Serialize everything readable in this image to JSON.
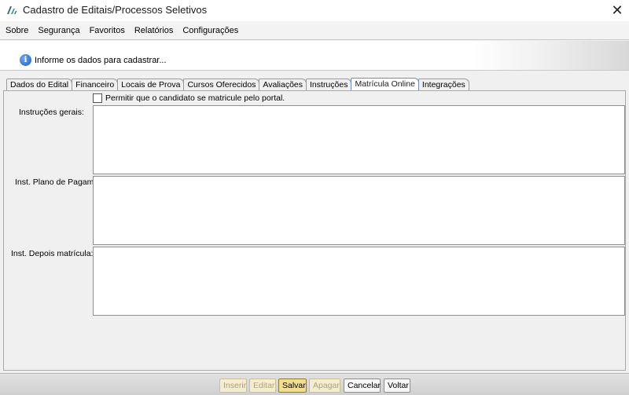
{
  "window": {
    "title": "Cadastro de Editais/Processos Seletivos",
    "close_label": "✕"
  },
  "menu": [
    {
      "label": "Sobre"
    },
    {
      "label": "Segurança"
    },
    {
      "label": "Favoritos"
    },
    {
      "label": "Relatórios"
    },
    {
      "label": "Configurações"
    }
  ],
  "banner": {
    "icon": "info-icon",
    "message": "Informe os dados para cadastrar..."
  },
  "tabs": [
    {
      "label": "Dados do Edital"
    },
    {
      "label": "Financeiro"
    },
    {
      "label": "Locais de Prova"
    },
    {
      "label": "Cursos Oferecidos"
    },
    {
      "label": "Avaliações"
    },
    {
      "label": "Instruções"
    },
    {
      "label": "Matrícula Online",
      "active": true
    },
    {
      "label": "Integrações"
    }
  ],
  "form": {
    "portal_checkbox_label": "Permitir que o candidato se matricule pelo portal.",
    "portal_checkbox_checked": false,
    "instrucoes_label": "Instruções gerais:",
    "plano_label": "Inst. Plano de Pagamento:",
    "depois_label": "Inst. Depois matrícula:",
    "instrucoes_value": "",
    "plano_value": "",
    "depois_value": ""
  },
  "buttons": {
    "inserir": "Inserir",
    "editar": "Editar",
    "salvar": "Salvar",
    "apagar": "Apagar",
    "cancelar": "Cancelar",
    "voltar": "Voltar"
  },
  "colors": {
    "active_tab_border": "#6b8cc4",
    "primary_button": "#f2de8d",
    "disabled_button": "#f4edd2"
  }
}
